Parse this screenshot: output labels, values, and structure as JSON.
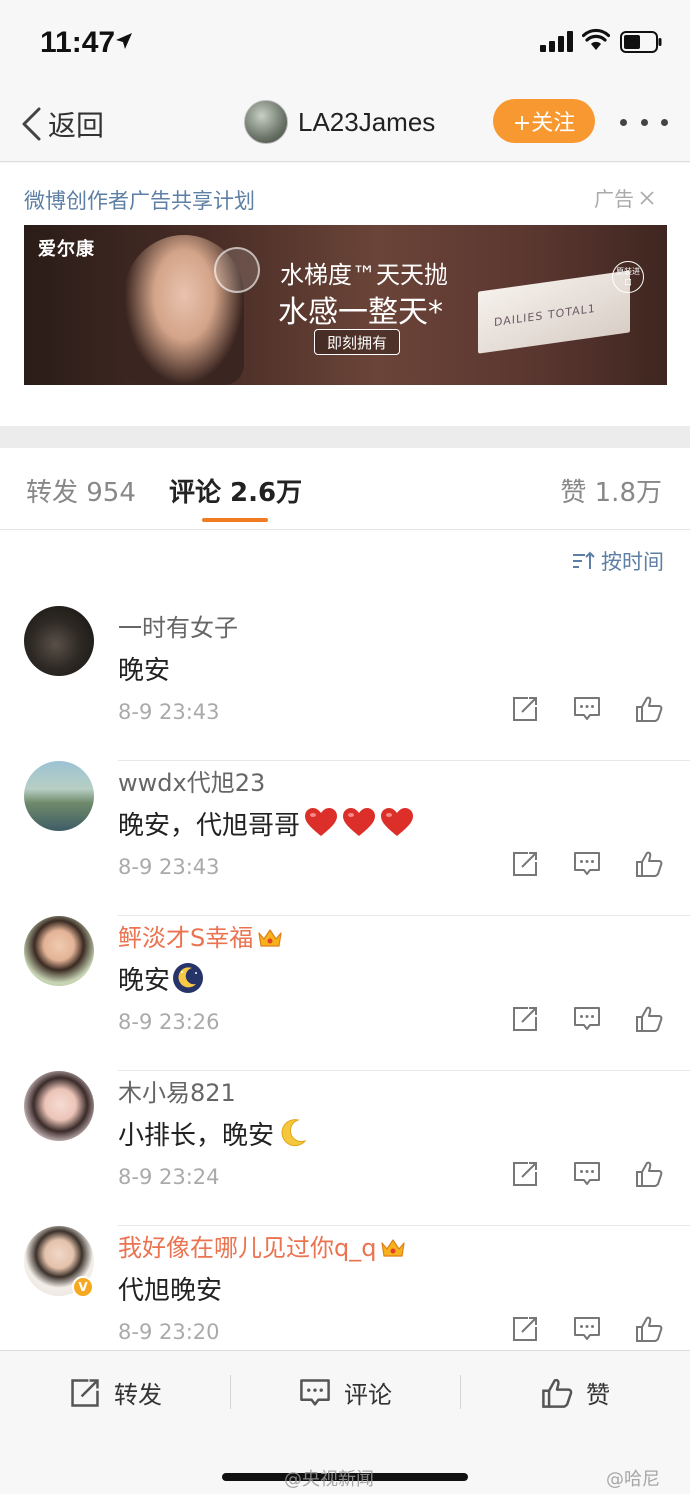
{
  "status_bar": {
    "time": "11:47"
  },
  "nav": {
    "back_label": "返回",
    "username": "LA23James",
    "follow_label": "+关注"
  },
  "ad": {
    "title": "微博创作者广告共享计划",
    "tag": "广告",
    "brand": "爱尔康",
    "headline_1": "水梯度™天天抛",
    "headline_2": "水感一整天*",
    "cta": "即刻拥有",
    "product": "DAILIES TOTAL1",
    "badge": "原装进口"
  },
  "tabs": {
    "repost": "转发 954",
    "comments": "评论 2.6万",
    "likes": "赞 1.8万"
  },
  "sort_label": "按时间",
  "comments": [
    {
      "name": "一时有女子",
      "text": "晚安",
      "time": "8-9 23:43"
    },
    {
      "name": "wwdx代旭23",
      "text": "晚安，代旭哥哥",
      "time": "8-9 23:43"
    },
    {
      "name": "鲆淡才S幸福",
      "text": "晚安",
      "time": "8-9 23:26"
    },
    {
      "name": "木小易821",
      "text": "小排长，晚安",
      "time": "8-9 23:24"
    },
    {
      "name": "我好像在哪儿见过你q_q",
      "text": "代旭晚安",
      "time": "8-9 23:20"
    }
  ],
  "bottom_bar": {
    "repost": "转发",
    "comment": "评论",
    "like": "赞"
  },
  "watermarks": {
    "left": "@央视新闻",
    "right": "@哈尼"
  }
}
